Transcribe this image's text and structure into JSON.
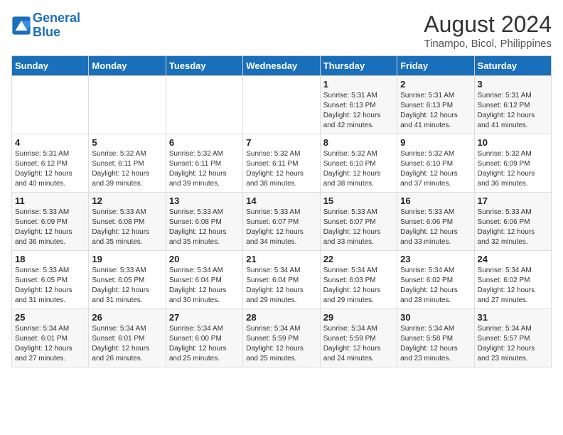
{
  "logo": {
    "line1": "General",
    "line2": "Blue"
  },
  "title": "August 2024",
  "subtitle": "Tinampo, Bicol, Philippines",
  "days_of_week": [
    "Sunday",
    "Monday",
    "Tuesday",
    "Wednesday",
    "Thursday",
    "Friday",
    "Saturday"
  ],
  "weeks": [
    [
      {
        "day": "",
        "info": ""
      },
      {
        "day": "",
        "info": ""
      },
      {
        "day": "",
        "info": ""
      },
      {
        "day": "",
        "info": ""
      },
      {
        "day": "1",
        "info": "Sunrise: 5:31 AM\nSunset: 6:13 PM\nDaylight: 12 hours\nand 42 minutes."
      },
      {
        "day": "2",
        "info": "Sunrise: 5:31 AM\nSunset: 6:13 PM\nDaylight: 12 hours\nand 41 minutes."
      },
      {
        "day": "3",
        "info": "Sunrise: 5:31 AM\nSunset: 6:12 PM\nDaylight: 12 hours\nand 41 minutes."
      }
    ],
    [
      {
        "day": "4",
        "info": "Sunrise: 5:31 AM\nSunset: 6:12 PM\nDaylight: 12 hours\nand 40 minutes."
      },
      {
        "day": "5",
        "info": "Sunrise: 5:32 AM\nSunset: 6:11 PM\nDaylight: 12 hours\nand 39 minutes."
      },
      {
        "day": "6",
        "info": "Sunrise: 5:32 AM\nSunset: 6:11 PM\nDaylight: 12 hours\nand 39 minutes."
      },
      {
        "day": "7",
        "info": "Sunrise: 5:32 AM\nSunset: 6:11 PM\nDaylight: 12 hours\nand 38 minutes."
      },
      {
        "day": "8",
        "info": "Sunrise: 5:32 AM\nSunset: 6:10 PM\nDaylight: 12 hours\nand 38 minutes."
      },
      {
        "day": "9",
        "info": "Sunrise: 5:32 AM\nSunset: 6:10 PM\nDaylight: 12 hours\nand 37 minutes."
      },
      {
        "day": "10",
        "info": "Sunrise: 5:32 AM\nSunset: 6:09 PM\nDaylight: 12 hours\nand 36 minutes."
      }
    ],
    [
      {
        "day": "11",
        "info": "Sunrise: 5:33 AM\nSunset: 6:09 PM\nDaylight: 12 hours\nand 36 minutes."
      },
      {
        "day": "12",
        "info": "Sunrise: 5:33 AM\nSunset: 6:08 PM\nDaylight: 12 hours\nand 35 minutes."
      },
      {
        "day": "13",
        "info": "Sunrise: 5:33 AM\nSunset: 6:08 PM\nDaylight: 12 hours\nand 35 minutes."
      },
      {
        "day": "14",
        "info": "Sunrise: 5:33 AM\nSunset: 6:07 PM\nDaylight: 12 hours\nand 34 minutes."
      },
      {
        "day": "15",
        "info": "Sunrise: 5:33 AM\nSunset: 6:07 PM\nDaylight: 12 hours\nand 33 minutes."
      },
      {
        "day": "16",
        "info": "Sunrise: 5:33 AM\nSunset: 6:06 PM\nDaylight: 12 hours\nand 33 minutes."
      },
      {
        "day": "17",
        "info": "Sunrise: 5:33 AM\nSunset: 6:06 PM\nDaylight: 12 hours\nand 32 minutes."
      }
    ],
    [
      {
        "day": "18",
        "info": "Sunrise: 5:33 AM\nSunset: 6:05 PM\nDaylight: 12 hours\nand 31 minutes."
      },
      {
        "day": "19",
        "info": "Sunrise: 5:33 AM\nSunset: 6:05 PM\nDaylight: 12 hours\nand 31 minutes."
      },
      {
        "day": "20",
        "info": "Sunrise: 5:34 AM\nSunset: 6:04 PM\nDaylight: 12 hours\nand 30 minutes."
      },
      {
        "day": "21",
        "info": "Sunrise: 5:34 AM\nSunset: 6:04 PM\nDaylight: 12 hours\nand 29 minutes."
      },
      {
        "day": "22",
        "info": "Sunrise: 5:34 AM\nSunset: 6:03 PM\nDaylight: 12 hours\nand 29 minutes."
      },
      {
        "day": "23",
        "info": "Sunrise: 5:34 AM\nSunset: 6:02 PM\nDaylight: 12 hours\nand 28 minutes."
      },
      {
        "day": "24",
        "info": "Sunrise: 5:34 AM\nSunset: 6:02 PM\nDaylight: 12 hours\nand 27 minutes."
      }
    ],
    [
      {
        "day": "25",
        "info": "Sunrise: 5:34 AM\nSunset: 6:01 PM\nDaylight: 12 hours\nand 27 minutes."
      },
      {
        "day": "26",
        "info": "Sunrise: 5:34 AM\nSunset: 6:01 PM\nDaylight: 12 hours\nand 26 minutes."
      },
      {
        "day": "27",
        "info": "Sunrise: 5:34 AM\nSunset: 6:00 PM\nDaylight: 12 hours\nand 25 minutes."
      },
      {
        "day": "28",
        "info": "Sunrise: 5:34 AM\nSunset: 5:59 PM\nDaylight: 12 hours\nand 25 minutes."
      },
      {
        "day": "29",
        "info": "Sunrise: 5:34 AM\nSunset: 5:59 PM\nDaylight: 12 hours\nand 24 minutes."
      },
      {
        "day": "30",
        "info": "Sunrise: 5:34 AM\nSunset: 5:58 PM\nDaylight: 12 hours\nand 23 minutes."
      },
      {
        "day": "31",
        "info": "Sunrise: 5:34 AM\nSunset: 5:57 PM\nDaylight: 12 hours\nand 23 minutes."
      }
    ]
  ]
}
